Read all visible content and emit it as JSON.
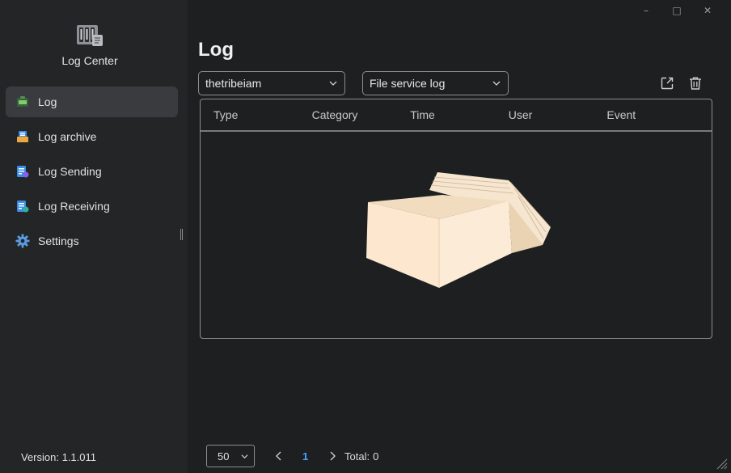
{
  "window": {
    "minimize": "–",
    "maximize": "□",
    "close": "✕"
  },
  "app": {
    "name": "Log Center",
    "version": "Version: 1.1.011",
    "logo_icon": "log-center-logo-icon"
  },
  "sidebar": {
    "items": [
      {
        "label": "Log",
        "icon": "log-icon",
        "active": true
      },
      {
        "label": "Log archive",
        "icon": "archive-icon",
        "active": false
      },
      {
        "label": "Log Sending",
        "icon": "log-sending-icon",
        "active": false
      },
      {
        "label": "Log Receiving",
        "icon": "log-receiving-icon",
        "active": false
      },
      {
        "label": "Settings",
        "icon": "gear-icon",
        "active": false
      }
    ]
  },
  "main": {
    "title": "Log",
    "host_select": {
      "value": "thetribeiam"
    },
    "log_type_select": {
      "value": "File service log"
    },
    "toolbar": {
      "export_icon": "export-icon",
      "delete_icon": "trash-icon"
    },
    "table": {
      "columns": [
        "Type",
        "Category",
        "Time",
        "User",
        "Event"
      ],
      "rows": []
    }
  },
  "pagination": {
    "page_size": "50",
    "current_page": "1",
    "total_label": "Total:",
    "total_value": "0"
  },
  "colors": {
    "background": "#1e1f21",
    "sidebar": "#232527",
    "active_item": "#393b3e",
    "accent": "#4aa3ff",
    "border": "#8d8d8d"
  }
}
